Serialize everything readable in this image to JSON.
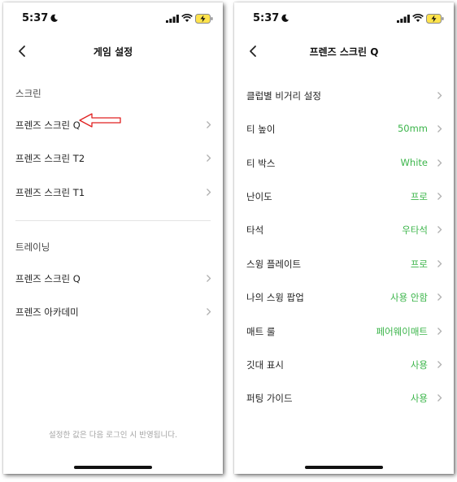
{
  "status": {
    "time": "5:37"
  },
  "left": {
    "title": "게임 설정",
    "sections": [
      {
        "header": "스크린",
        "items": [
          "프렌즈 스크린 Q",
          "프렌즈 스크린 T2",
          "프렌즈 스크린 T1"
        ]
      },
      {
        "header": "트레이닝",
        "items": [
          "프렌즈 스크린 Q",
          "프렌즈 아카데미"
        ]
      }
    ],
    "footer": "설정한 값은 다음 로그인 시 반영됩니다."
  },
  "right": {
    "title": "프렌즈 스크린 Q",
    "rows": [
      {
        "label": "클럽별 비거리 설정",
        "value": ""
      },
      {
        "label": "티 높이",
        "value": "50mm"
      },
      {
        "label": "티 박스",
        "value": "White"
      },
      {
        "label": "난이도",
        "value": "프로"
      },
      {
        "label": "타석",
        "value": "우타석"
      },
      {
        "label": "스윙 플레이트",
        "value": "프로"
      },
      {
        "label": "나의 스윙 팝업",
        "value": "사용 안함"
      },
      {
        "label": "매트 룰",
        "value": "페어웨이매트"
      },
      {
        "label": "깃대 표시",
        "value": "사용"
      },
      {
        "label": "퍼팅 가이드",
        "value": "사용"
      }
    ]
  },
  "colors": {
    "accent_green": "#3bb54a",
    "annotation_red": "#e02020"
  },
  "icons": [
    "moon-icon",
    "signal-icon",
    "wifi-icon",
    "battery-charging-icon",
    "back-icon",
    "chevron-right-icon",
    "red-arrow-annotation"
  ]
}
